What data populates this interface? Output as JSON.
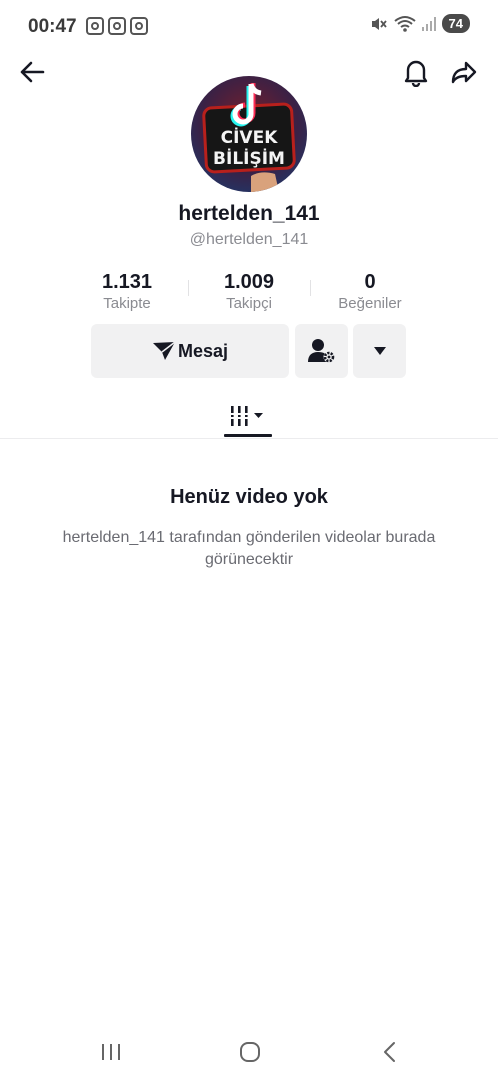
{
  "status_bar": {
    "time": "00:47",
    "notification_icons": [
      "instagram-icon",
      "instagram-icon",
      "instagram-icon"
    ],
    "right_icons": [
      "mute-icon",
      "wifi-icon",
      "signal-icon"
    ],
    "battery": "74"
  },
  "header": {
    "back_icon": "arrow-left-icon",
    "bell_icon": "bell-icon",
    "share_icon": "share-arrow-icon"
  },
  "profile": {
    "avatar_text_line1": "CİVEK",
    "avatar_text_line2": "BİLİŞİM",
    "username": "hertelden_141",
    "handle": "@hertelden_141"
  },
  "stats": [
    {
      "value": "1.131",
      "label": "Takipte"
    },
    {
      "value": "1.009",
      "label": "Takipçi"
    },
    {
      "value": "0",
      "label": "Beğeniler"
    }
  ],
  "actions": {
    "message_label": "Mesaj",
    "message_icon": "send-icon",
    "friend_settings_icon": "user-gear-icon",
    "more_icon": "caret-down-icon"
  },
  "tabs": {
    "active_icon": "videos-grid-icon"
  },
  "empty_state": {
    "title": "Henüz video yok",
    "description": "hertelden_141 tarafından gönderilen videolar burada görünecektir"
  },
  "nav": {
    "recent_icon": "recent-apps-icon",
    "home_icon": "home-icon",
    "back_icon": "back-icon"
  },
  "colors": {
    "text": "#161823",
    "secondary": "#8a8b91",
    "button_bg": "#f1f1f2"
  }
}
